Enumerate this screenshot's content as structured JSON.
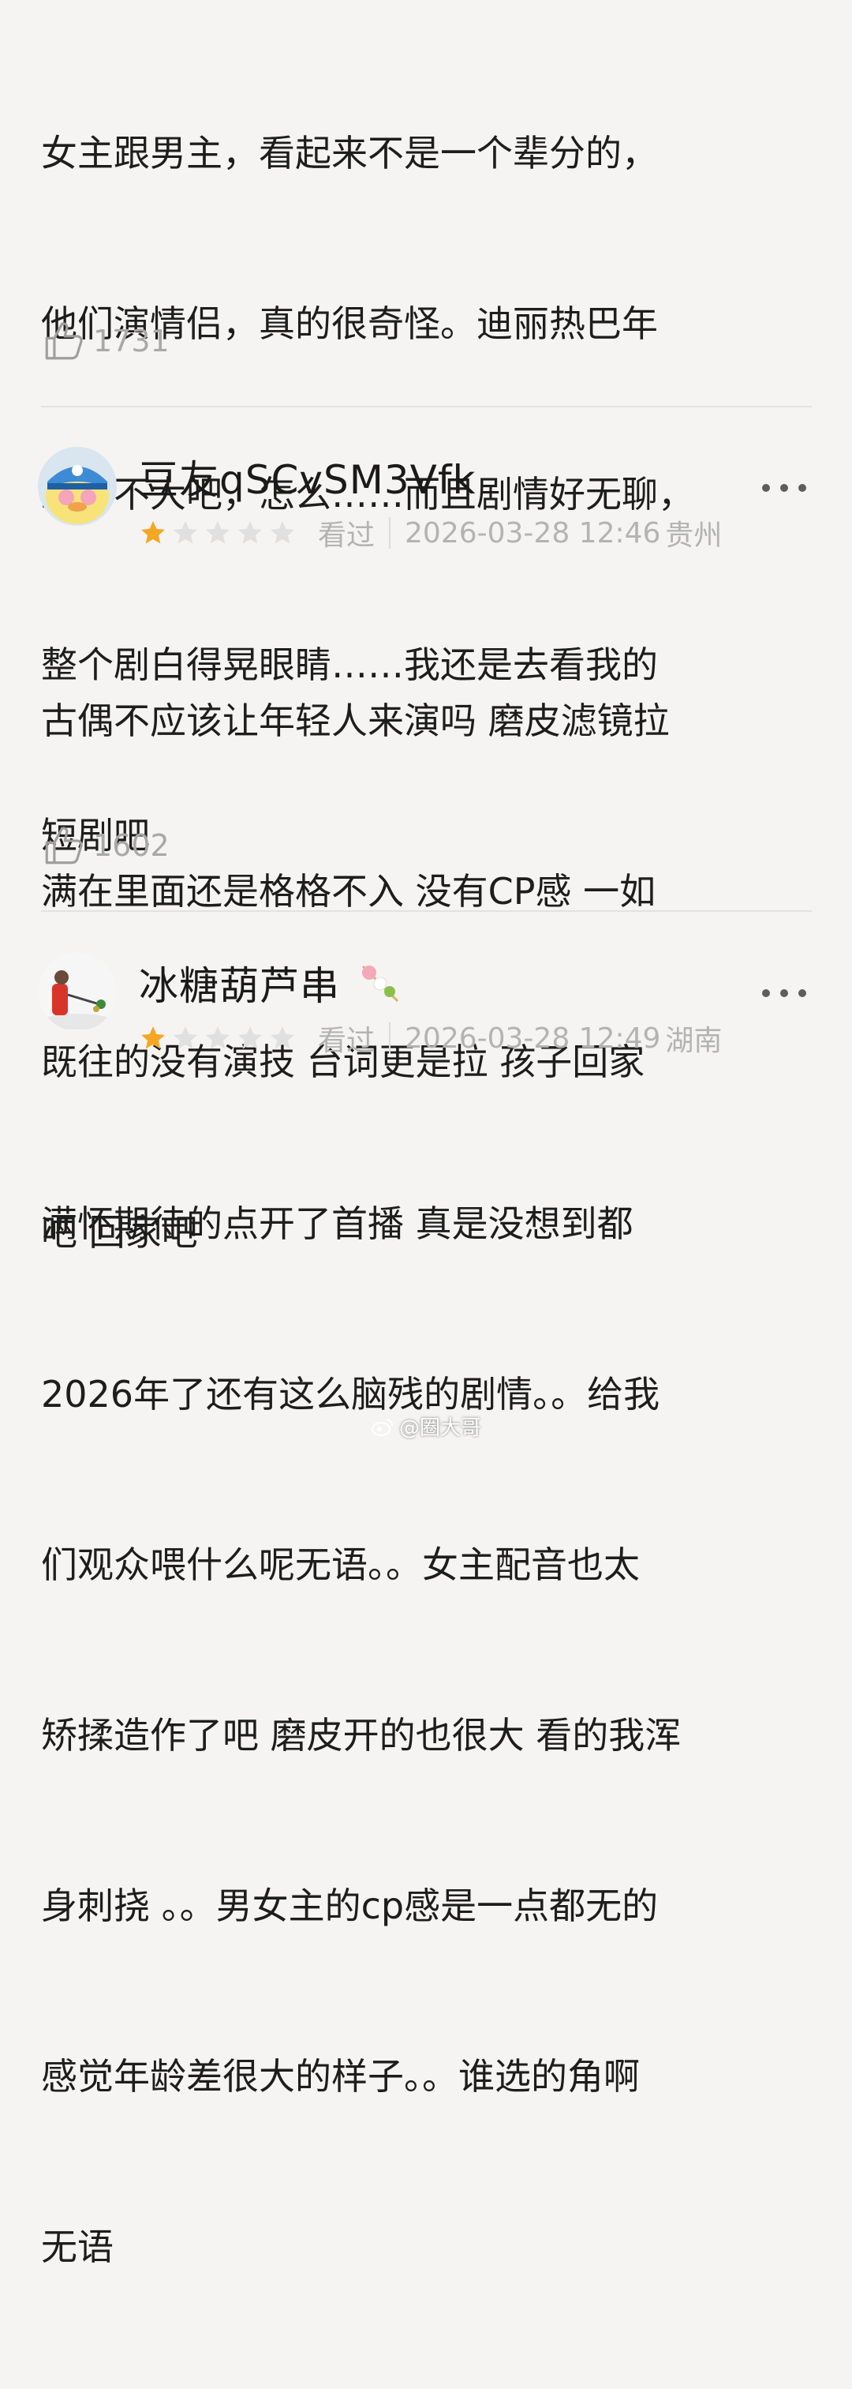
{
  "reviews": [
    {
      "text_lines": [
        "女主跟男主，看起来不是一个辈分的，",
        "他们演情侣，真的很奇怪。迪丽热巴年",
        "纪也不大吧，怎么……而且剧情好无聊，",
        "整个剧白得晃眼睛……我还是去看我的",
        "短剧吧"
      ],
      "likes": "1731"
    },
    {
      "username": "豆友qSCvSM3Vfk",
      "rating": 1,
      "status": "看过",
      "datetime": "2026-03-28 12:46",
      "location": "贵州",
      "text_lines": [
        "古偶不应该让年轻人来演吗  磨皮滤镜拉",
        "满在里面还是格格不入  没有CP感  一如",
        "既往的没有演技 台词更是拉   孩子回家",
        "吧 回家吧"
      ],
      "likes": "1602"
    },
    {
      "username": "冰糖葫芦串",
      "rating": 1,
      "status": "看过",
      "datetime": "2026-03-28 12:49",
      "location": "湖南",
      "text_lines": [
        "满怀期待的点开了首播 真是没想到都",
        "2026年了还有这么脑残的剧情。。给我",
        "们观众喂什么呢无语。。女主配音也太",
        "矫揉造作了吧 磨皮开的也很大 看的我浑",
        "身刺挠 。。男女主的cp感是一点都无的",
        "感觉年龄差很大的样子。。谁选的角啊",
        "无语"
      ]
    }
  ],
  "watermark": "@圈大哥",
  "colors": {
    "star_filled": "#f5a623",
    "star_empty": "#e0e0e0",
    "background": "#f5f4f2"
  },
  "icons": {
    "like": "thumbs-up-icon",
    "more": "more-dots-icon",
    "watermark": "weibo-icon"
  }
}
